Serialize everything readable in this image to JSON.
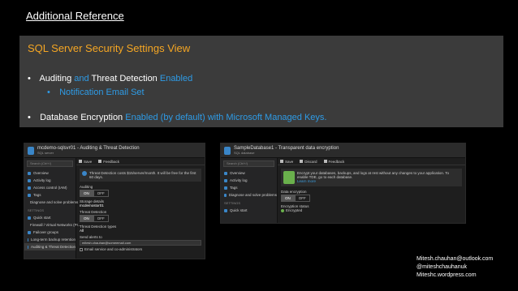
{
  "slide": {
    "title": "Additional Reference"
  },
  "panel": {
    "title": "SQL Server Security Settings View",
    "bullet1": {
      "pre": "Auditing ",
      "and": "and",
      "mid": " Threat Detection ",
      "status": "Enabled"
    },
    "bullet2": "Notification Email Set",
    "bullet3": {
      "pre": "Database Encryption ",
      "status": "Enabled (by default) with Microsoft Managed Keys."
    }
  },
  "colors": {
    "accent_orange": "#f5a623",
    "accent_blue": "#2e9be6",
    "panel_bg": "#3b3b3b",
    "ok_green": "#6ab04c"
  },
  "shot1": {
    "title": "mcdemo-sqlsvr01 - Auditing & Threat Detection",
    "subtitle": "SQL server",
    "search": "Search (Ctrl+/)",
    "nav": [
      "Overview",
      "Activity log",
      "Access control (IAM)",
      "Tags",
      "Diagnose and solve problems"
    ],
    "section": "SETTINGS",
    "nav2": [
      "Quick start",
      "Firewall / Virtual Networks (Pr...",
      "Failover groups",
      "Long-term backup retention",
      "Auditing & Threat Detection"
    ],
    "toolbar": {
      "save": "Save",
      "feedback": "Feedback"
    },
    "banner": "Threat Detection costs $15/server/month. It will be free for the first 60 days.",
    "auditing_label": "Auditing",
    "on": "ON",
    "off": "OFF",
    "storage_label": "Storage details",
    "storage_value": "mcdemostor01",
    "td_label": "Threat Detection",
    "td_types_label": "Threat Detection types",
    "td_types_value": "All",
    "send_alerts_label": "Send alerts to",
    "send_alerts_value": "mitesh.chauhan@someemail.com",
    "email_admins": "Email service and co-administrators"
  },
  "shot2": {
    "title": "SampleDatabase1 - Transparent data encryption",
    "subtitle": "SQL database",
    "search": "Search (Ctrl+/)",
    "nav": [
      "Overview",
      "Activity log",
      "Tags",
      "Diagnose and solve problems"
    ],
    "section": "SETTINGS",
    "nav2": [
      "Quick start"
    ],
    "toolbar": {
      "save": "Save",
      "discard": "Discard",
      "feedback": "Feedback"
    },
    "banner": "Encrypt your databases, backups, and logs at rest without any changes to your application. To enable TDE, go to each database.",
    "learn_more": "Learn more",
    "encryption_label": "Data encryption",
    "on": "ON",
    "off": "OFF",
    "status_label": "Encryption status",
    "status_value": "Encrypted"
  },
  "contact": {
    "email": "Mitesh.chauhan@outlook.com",
    "twitter": "@miteshchauhanuk",
    "blog": "Miteshc.wordpress.com"
  }
}
